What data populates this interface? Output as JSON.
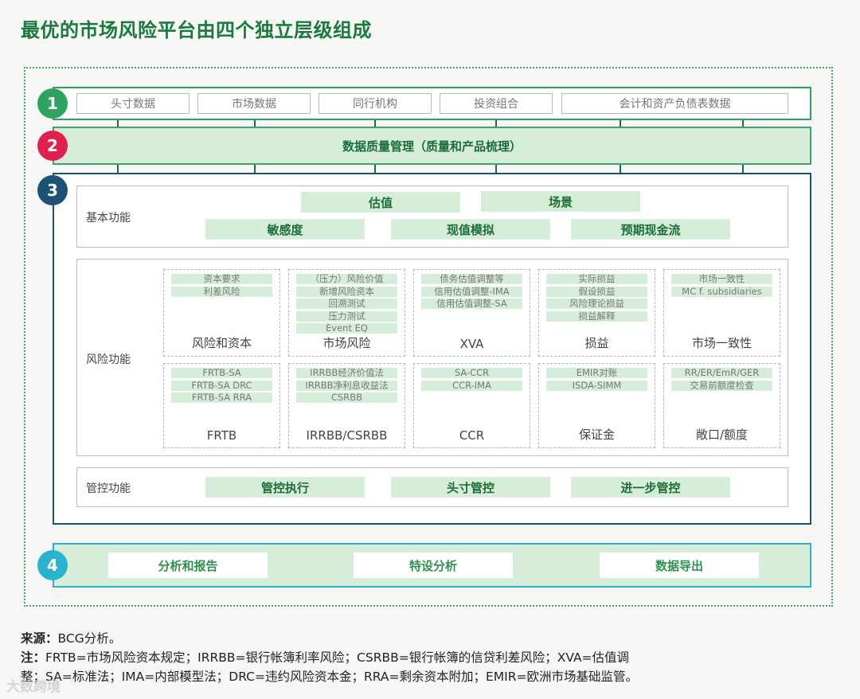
{
  "title": "最优的市场风险平台由四个独立层级组成",
  "colors": {
    "layer1": "#2fa260",
    "layer2": "#e0204e",
    "layer3": "#1d5277",
    "layer4": "#29b3cf"
  },
  "layer1": {
    "number": "1",
    "items": [
      "头寸数据",
      "市场数据",
      "同行机构",
      "投资组合",
      "会计和资产负债表数据"
    ]
  },
  "layer2": {
    "number": "2",
    "label": "数据质量管理（质量和产品梳理）"
  },
  "layer3": {
    "number": "3",
    "basic": {
      "label": "基本功能",
      "items": [
        "估值",
        "场景",
        "敏感度",
        "现值模拟",
        "预期现金流"
      ]
    },
    "risk": {
      "label": "风险功能",
      "top": [
        {
          "items": [
            "资本要求",
            "利差风险"
          ],
          "title": "风险和资本"
        },
        {
          "items": [
            "（压力）风险价值",
            "新增风险资本",
            "回溯测试",
            "压力测试",
            "Event EQ"
          ],
          "title": "市场风险"
        },
        {
          "items": [
            "债务估值调整等",
            "信用估值调整-IMA",
            "信用估值调整-SA"
          ],
          "title": "XVA"
        },
        {
          "items": [
            "实际损益",
            "假设损益",
            "风险理论损益",
            "损益解释"
          ],
          "title": "损益"
        },
        {
          "items": [
            "市场一致性",
            "MC f. subsidiaries"
          ],
          "title": "市场一致性"
        }
      ],
      "bottom": [
        {
          "items": [
            "FRTB-SA",
            "FRTB-SA DRC",
            "FRTB-SA RRA"
          ],
          "title": "FRTB"
        },
        {
          "items": [
            "IRRBB经济价值法",
            "IRRBB净利息收益法",
            "CSRBB"
          ],
          "title": "IRRBB/CSRBB"
        },
        {
          "items": [
            "SA-CCR",
            "CCR-IMA"
          ],
          "title": "CCR"
        },
        {
          "items": [
            "EMIR对账",
            "ISDA-SIMM"
          ],
          "title": "保证金"
        },
        {
          "items": [
            "RR/ER/EmR/GER",
            "交易前额度检查"
          ],
          "title": "敞口/额度"
        }
      ]
    },
    "control": {
      "label": "管控功能",
      "items": [
        "管控执行",
        "头寸管控",
        "进一步管控"
      ]
    }
  },
  "layer4": {
    "number": "4",
    "items": [
      "分析和报告",
      "特设分析",
      "数据导出"
    ]
  },
  "footer": {
    "source_label": "来源：",
    "source_text": "BCG分析。",
    "note_label": "注：",
    "note_line1": "FRTB=市场风险资本规定；IRRBB=银行帐簿利率风险；CSRBB=银行帐簿的信贷利差风险；XVA=估值调",
    "note_line2": "整；SA=标准法；IMA=内部模型法；DRC=违约风险资本金；RRA=剩余资本附加；EMIR=欧洲市场基础监管。"
  },
  "watermark": "大数跨境"
}
